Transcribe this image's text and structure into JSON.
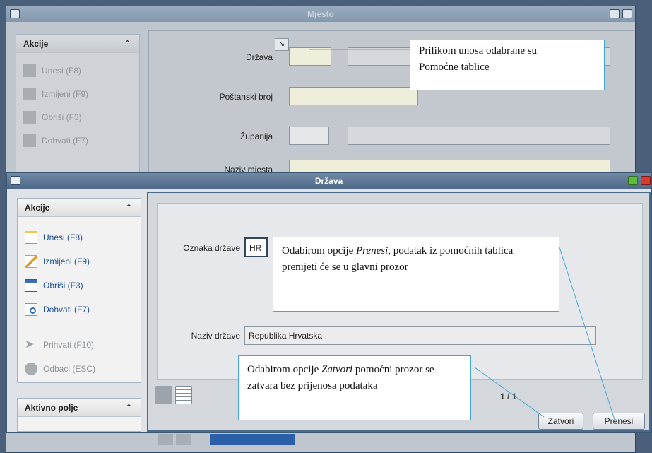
{
  "back_window": {
    "title": "Mjesto",
    "actions_header": "Akcije",
    "actions": [
      {
        "label": "Unesi (F8)"
      },
      {
        "label": "Izmijeni (F9)"
      },
      {
        "label": "Obriši (F3)"
      },
      {
        "label": "Dohvati (F7)"
      }
    ],
    "fields": {
      "drzava_label": "Država",
      "postanski_label": "Poštanski broj",
      "zupanija_label": "Županija",
      "naziv_mjesta_label": "Naziv mjesta"
    }
  },
  "front_window": {
    "title": "Država",
    "actions_header": "Akcije",
    "actions": [
      {
        "label": "Unesi (F8)"
      },
      {
        "label": "Izmijeni (F9)"
      },
      {
        "label": "Obriši (F3)"
      },
      {
        "label": "Dohvati (F7)"
      },
      {
        "label": "Prihvati (F10)"
      },
      {
        "label": "Odbaci (ESC)"
      }
    ],
    "aktivno_polje_header": "Aktivno polje",
    "oznaka_label": "Oznaka države",
    "oznaka_value": "HR",
    "naziv_label": "Naziv države",
    "naziv_value": "Republika Hrvatska",
    "record_counter": "1 / 1",
    "zatvori_label": "Zatvori",
    "prenesi_label": "Prenesi"
  },
  "callouts": {
    "top_line1": "Prilikom unosa odabrane su",
    "top_line2": "Pomoćne tablice",
    "middle_pre": "Odabirom opcije ",
    "middle_em": "Prenesi",
    "middle_post": ", podatak iz pomoćnih tablica prenijeti će se u glavni prozor",
    "bottom_pre": "Odabirom opcije ",
    "bottom_em": "Zatvori",
    "bottom_post": " pomoćni prozor se zatvara bez prijenosa podataka"
  },
  "colors": {
    "title_bar": "#5a7593",
    "callout_border": "#43a7d6",
    "field_yellow": "#ffffe0",
    "maximize_green": "#5cbf3a",
    "close_red": "#d9392f"
  }
}
